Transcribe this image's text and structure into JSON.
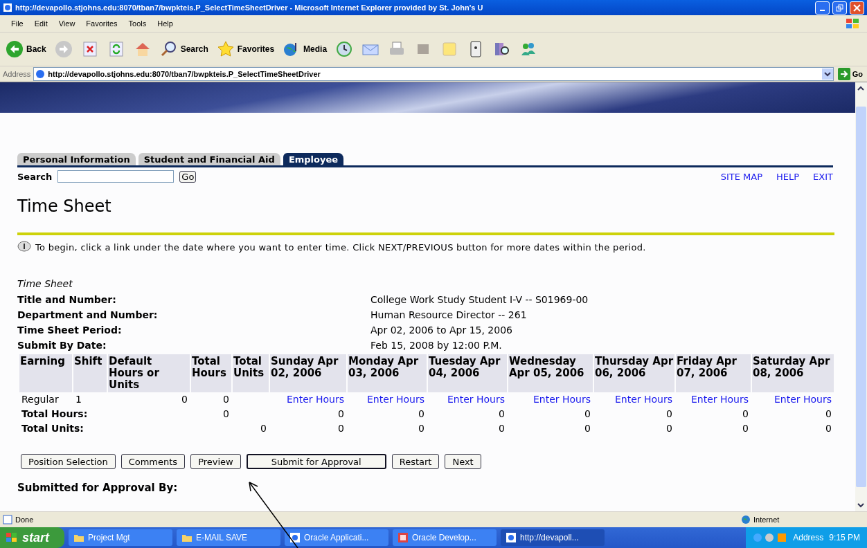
{
  "window": {
    "title": "http://devapollo.stjohns.edu:8070/tban7/bwpkteis.P_SelectTimeSheetDriver - Microsoft Internet Explorer provided by St. John's U"
  },
  "menu": [
    "File",
    "Edit",
    "View",
    "Favorites",
    "Tools",
    "Help"
  ],
  "toolbar": [
    {
      "kind": "back",
      "label": "Back"
    },
    {
      "kind": "forward"
    },
    {
      "kind": "stop"
    },
    {
      "kind": "refresh"
    },
    {
      "kind": "home"
    },
    {
      "kind": "search",
      "label": "Search"
    },
    {
      "kind": "favorites",
      "label": "Favorites"
    },
    {
      "kind": "media",
      "label": "Media"
    },
    {
      "kind": "history"
    },
    {
      "kind": "mail"
    },
    {
      "kind": "print"
    },
    {
      "kind": "edit"
    },
    {
      "kind": "note"
    },
    {
      "kind": "device"
    },
    {
      "kind": "research"
    },
    {
      "kind": "messenger"
    }
  ],
  "address": {
    "label": "Address",
    "url": "http://devapollo.stjohns.edu:8070/tban7/bwpkteis.P_SelectTimeSheetDriver",
    "go": "Go"
  },
  "tabs": [
    {
      "label": "Personal Information",
      "selected": false
    },
    {
      "label": "Student and Financial Aid",
      "selected": false
    },
    {
      "label": "Employee",
      "selected": true
    }
  ],
  "search": {
    "label": "Search",
    "button": "Go"
  },
  "links": [
    "SITE MAP",
    "HELP",
    "EXIT"
  ],
  "page_title": "Time Sheet",
  "info": "To begin, click a link under the date where you want to enter time. Click NEXT/PREVIOUS button for more dates within the period.",
  "section_title": "Time Sheet",
  "details": [
    {
      "label": "Title and Number:",
      "value": "College Work Study Student I-V -- S01969-00"
    },
    {
      "label": "Department and Number:",
      "value": "Human Resource Director -- 261"
    },
    {
      "label": "Time Sheet Period:",
      "value": "Apr 02, 2006 to Apr 15, 2006"
    },
    {
      "label": "Submit By Date:",
      "value": "Feb 15, 2008 by 12:00 P.M."
    }
  ],
  "table": {
    "columns": [
      "Earning",
      "Shift",
      "Default Hours or Units",
      "Total Hours",
      "Total Units",
      "Sunday Apr 02, 2006",
      "Monday Apr 03, 2006",
      "Tuesday Apr 04, 2006",
      "Wednesday Apr 05, 2006",
      "Thursday Apr 06, 2006",
      "Friday Apr 07, 2006",
      "Saturday Apr 08, 2006"
    ],
    "rows": [
      {
        "kind": "entry",
        "earning": "Regular",
        "shift": "1",
        "default": "0",
        "total_hours": "0",
        "days": [
          "Enter Hours",
          "Enter Hours",
          "Enter Hours",
          "Enter Hours",
          "Enter Hours",
          "Enter Hours",
          "Enter Hours"
        ]
      },
      {
        "kind": "total_hours",
        "label": "Total Hours:",
        "total_hours": "0",
        "days": [
          "0",
          "0",
          "0",
          "0",
          "0",
          "0",
          "0"
        ]
      },
      {
        "kind": "total_units",
        "label": "Total Units:",
        "total_units": "0",
        "days": [
          "0",
          "0",
          "0",
          "0",
          "0",
          "0",
          "0"
        ]
      }
    ]
  },
  "buttons": [
    {
      "label": "Position Selection",
      "default": false
    },
    {
      "label": "Comments",
      "default": false
    },
    {
      "label": "Preview",
      "default": false
    },
    {
      "label": "Submit for Approval",
      "default": true
    },
    {
      "label": "Restart",
      "default": false
    },
    {
      "label": "Next",
      "default": false
    }
  ],
  "next_section": "Submitted for Approval By:",
  "status": {
    "text": "Done",
    "zone": "Internet"
  },
  "taskbar": {
    "start": "start",
    "tasks": [
      {
        "label": "Project Mgt",
        "kind": "folder",
        "selected": false
      },
      {
        "label": "E-MAIL SAVE",
        "kind": "folder",
        "selected": false
      },
      {
        "label": "Oracle Applicati...",
        "kind": "browser",
        "selected": false
      },
      {
        "label": "Oracle Develop...",
        "kind": "app",
        "selected": false
      },
      {
        "label": "http://devapoll...",
        "kind": "browser",
        "selected": true
      }
    ],
    "address": "Address",
    "time": "9:15 PM"
  }
}
